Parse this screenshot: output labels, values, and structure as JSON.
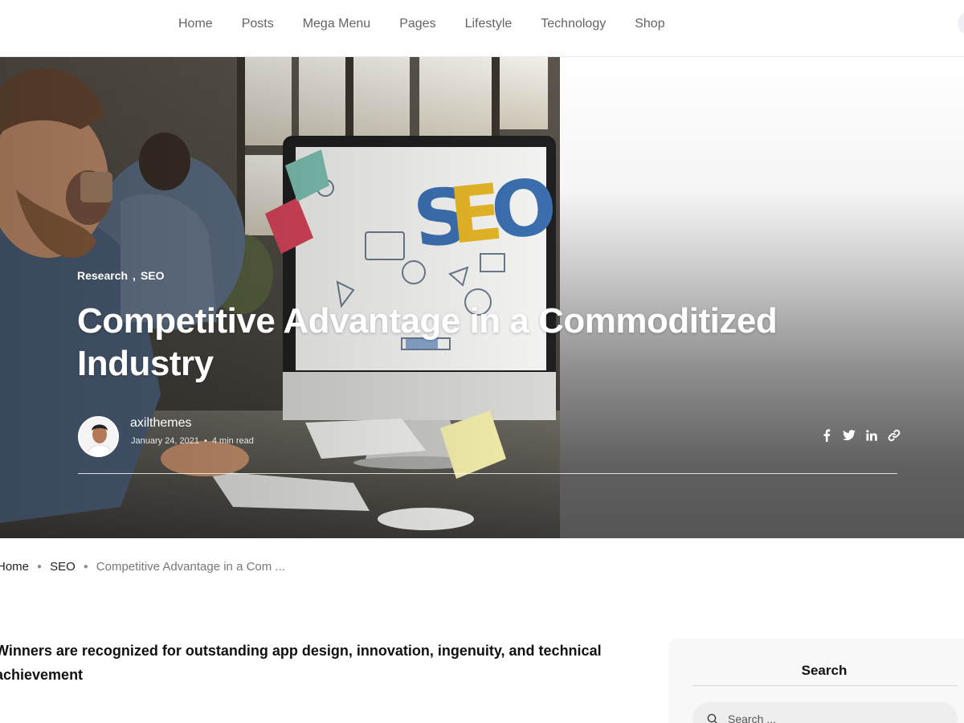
{
  "nav": {
    "items": [
      "Home",
      "Posts",
      "Mega Menu",
      "Pages",
      "Lifestyle",
      "Technology",
      "Shop"
    ]
  },
  "hero": {
    "categories": [
      "Research",
      "SEO"
    ],
    "category_separator": ",",
    "title": "Competitive Advantage in a Commoditized Industry",
    "author": {
      "name": "axilthemes",
      "date": "January 24, 2021",
      "read_time": "4 min read"
    },
    "share_icons": [
      "facebook-icon",
      "twitter-icon",
      "linkedin-icon",
      "link-icon"
    ]
  },
  "breadcrumb": {
    "items": [
      "Home",
      "SEO"
    ],
    "current": "Competitive Advantage in a Com ..."
  },
  "article": {
    "intro": "Winners are recognized for outstanding app design, innovation, ingenuity, and technical achievement"
  },
  "sidebar": {
    "search": {
      "title": "Search",
      "placeholder": "Search ..."
    }
  },
  "colors": {
    "nav_text": "#646464",
    "hero_text": "#ffffff",
    "body_text": "#111111",
    "sidebar_bg": "#f8f8f8"
  }
}
